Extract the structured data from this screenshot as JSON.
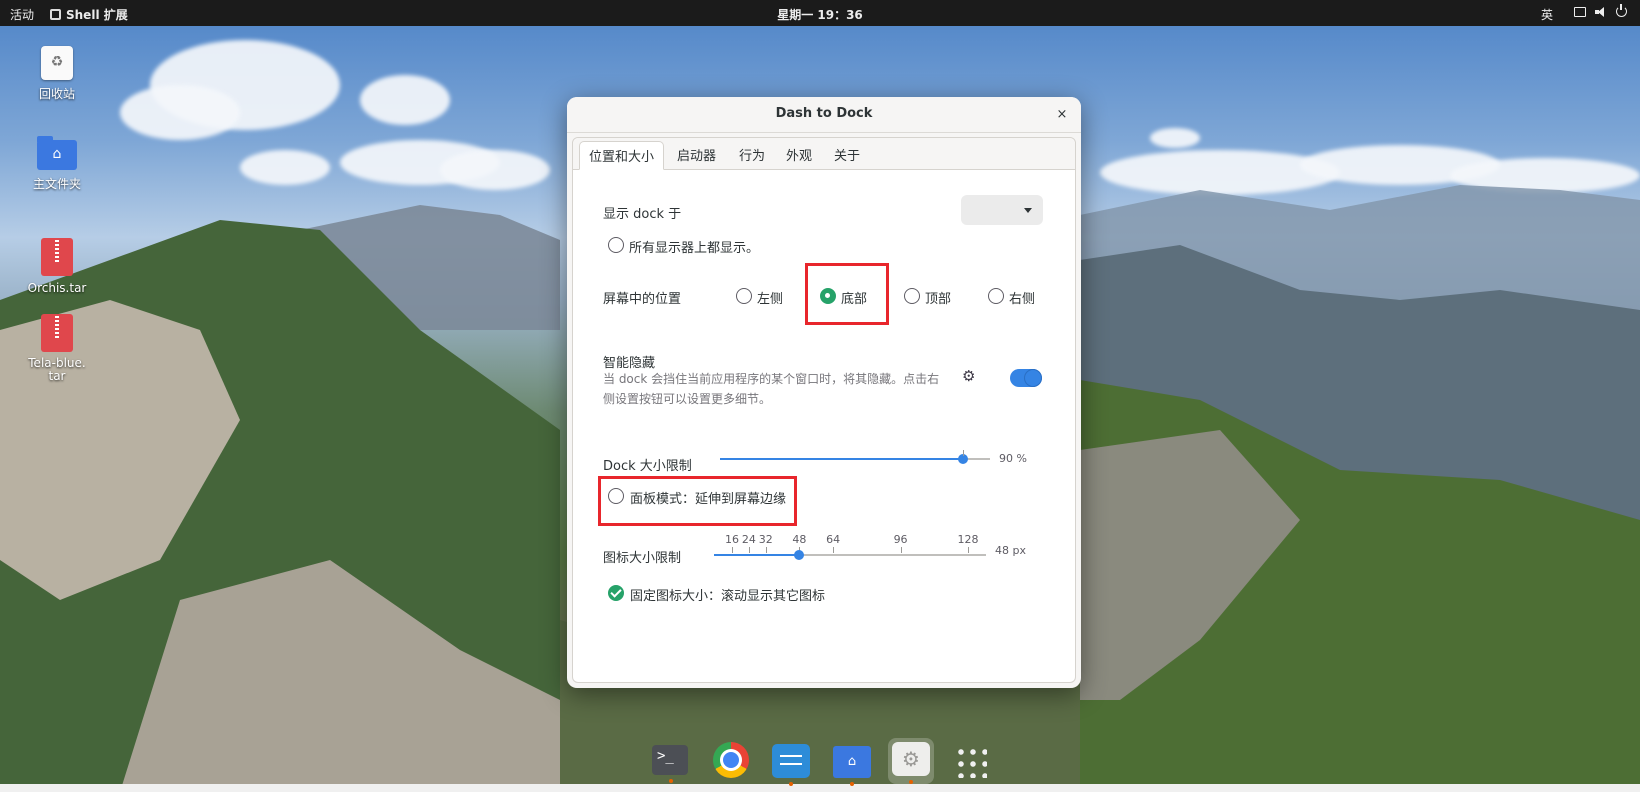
{
  "topbar": {
    "activities": "活动",
    "app_menu": "Shell 扩展",
    "clock": "星期一 19：36",
    "input_method": "英"
  },
  "desktop": {
    "icons": [
      {
        "label": "回收站"
      },
      {
        "label": "主文件夹"
      },
      {
        "label": "Orchis.tar"
      },
      {
        "label": "Tela-blue.\ntar"
      }
    ]
  },
  "dialog": {
    "title": "Dash to Dock",
    "close": "×",
    "tabs": [
      "位置和大小",
      "启动器",
      "行为",
      "外观",
      "关于"
    ],
    "active_tab": 0,
    "show_on_label": "显示 dock 于",
    "show_on_selected": "",
    "all_monitors_label": "所有显示器上都显示。",
    "all_monitors_checked": false,
    "position_label": "屏幕中的位置",
    "positions": [
      "左侧",
      "底部",
      "顶部",
      "右侧"
    ],
    "position_selected": "底部",
    "intellihide_title": "智能隐藏",
    "intellihide_desc": "当 dock 会挡住当前应用程序的某个窗口时，将其隐藏。点击右侧设置按钮可以设置更多细节。",
    "intellihide_enabled": true,
    "dock_size_label": "Dock 大小限制",
    "dock_size_value": "90 %",
    "dock_size_fraction": 0.9,
    "panel_mode_label": "面板模式：延伸到屏幕边缘",
    "panel_mode_checked": false,
    "icon_size_label": "图标大小限制",
    "icon_size_marks": [
      "16",
      "24",
      "32",
      "48",
      "64",
      "96",
      "128"
    ],
    "icon_size_value": "48 px",
    "icon_size_current": 48,
    "fixed_icon_label": "固定图标大小：滚动显示其它图标",
    "fixed_icon_checked": true
  },
  "dock": {
    "items": [
      "terminal-icon",
      "chrome-icon",
      "settings-icon",
      "files-icon",
      "extensions-icon",
      "show-apps-icon"
    ]
  },
  "colors": {
    "accent": "#3584e4",
    "radio_selected": "#26a269",
    "highlight_box": "#e8262c",
    "topbar_bg": "#1b1b1b"
  }
}
